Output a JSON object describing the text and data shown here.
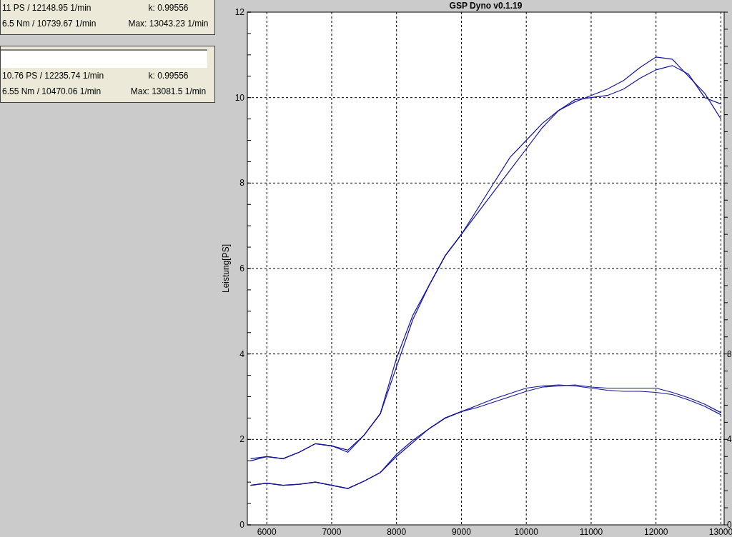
{
  "panels": [
    {
      "field": false,
      "rows": [
        {
          "reading": "11 PS / 12148.95 1/min",
          "info": "k: 0.99556"
        },
        {
          "reading": "6.5 Nm / 10739.67 1/min",
          "info": "Max: 13043.23 1/min"
        }
      ]
    },
    {
      "field": true,
      "rows": [
        {
          "reading": "10.76 PS / 12235.74 1/min",
          "info": "k: 0.99556"
        },
        {
          "reading": "6.55 Nm / 10470.06 1/min",
          "info": "Max: 13081.5 1/min"
        }
      ]
    }
  ],
  "chart_data": {
    "type": "line",
    "title": "GSP Dyno v0.1.19",
    "ylabel": "Leistung[PS]",
    "xlim": [
      5700,
      13050
    ],
    "ylim": [
      0,
      12
    ],
    "y2lim": [
      0,
      24
    ],
    "xticks": [
      6000,
      7000,
      8000,
      9000,
      10000,
      11000,
      12000,
      13000
    ],
    "yticks": [
      0,
      2,
      4,
      6,
      8,
      10,
      12
    ],
    "y2ticks": [
      0,
      4,
      8
    ],
    "grid": true,
    "x": [
      5750,
      6000,
      6250,
      6500,
      6750,
      7000,
      7250,
      7500,
      7750,
      8000,
      8250,
      8500,
      8750,
      9000,
      9250,
      9500,
      9750,
      10000,
      10250,
      10500,
      10750,
      11000,
      11250,
      11500,
      11750,
      12000,
      12250,
      12500,
      12750,
      13000
    ],
    "series": [
      {
        "color": "#1414a0",
        "values": [
          1.55,
          1.6,
          1.55,
          1.7,
          1.9,
          1.85,
          1.75,
          2.1,
          2.6,
          3.9,
          4.9,
          5.6,
          6.3,
          6.8,
          7.4,
          8.0,
          8.6,
          9.0,
          9.4,
          9.7,
          9.9,
          10.05,
          10.2,
          10.4,
          10.7,
          10.95,
          10.9,
          10.5,
          10.1,
          9.5
        ]
      },
      {
        "color": "#1414a0",
        "values": [
          1.5,
          1.6,
          1.55,
          1.7,
          1.9,
          1.85,
          1.7,
          2.1,
          2.6,
          3.7,
          4.8,
          5.6,
          6.3,
          6.8,
          7.3,
          7.8,
          8.3,
          8.8,
          9.3,
          9.7,
          9.95,
          10.0,
          10.05,
          10.2,
          10.45,
          10.65,
          10.75,
          10.55,
          10.0,
          9.85
        ]
      },
      {
        "color": "#1414a0",
        "axis": "y2",
        "values": [
          1.85,
          1.95,
          1.85,
          1.9,
          2.0,
          1.85,
          1.7,
          2.05,
          2.45,
          3.3,
          3.95,
          4.5,
          5.0,
          5.3,
          5.6,
          5.9,
          6.15,
          6.4,
          6.5,
          6.55,
          6.5,
          6.4,
          6.3,
          6.25,
          6.25,
          6.2,
          6.1,
          5.85,
          5.55,
          5.15
        ]
      },
      {
        "color": "#1414a0",
        "axis": "y2",
        "values": [
          1.85,
          1.95,
          1.85,
          1.9,
          2.0,
          1.85,
          1.7,
          2.05,
          2.45,
          3.2,
          3.85,
          4.5,
          5.0,
          5.3,
          5.5,
          5.75,
          6.0,
          6.25,
          6.45,
          6.5,
          6.55,
          6.45,
          6.4,
          6.4,
          6.4,
          6.4,
          6.2,
          5.95,
          5.65,
          5.25
        ]
      }
    ]
  }
}
